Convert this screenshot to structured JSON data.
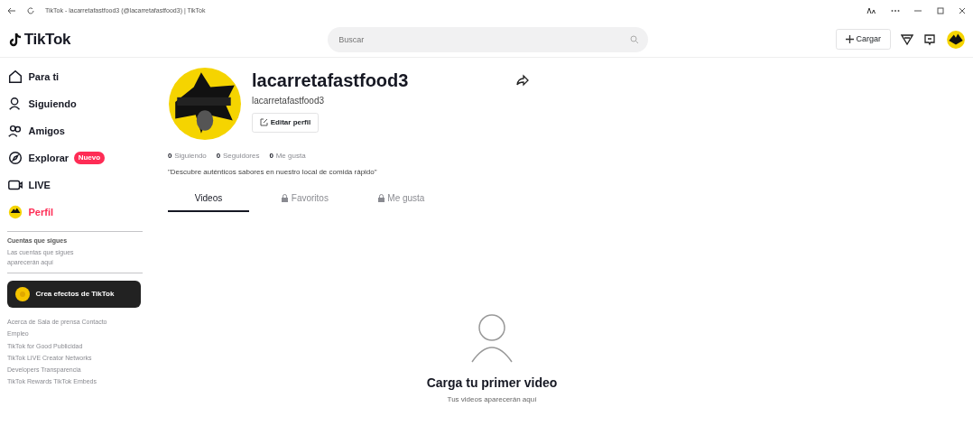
{
  "browser": {
    "title": "TikTok - lacarretafastfood3 (@lacarretafastfood3) | TikTok"
  },
  "header": {
    "logo": "TikTok",
    "search": {
      "placeholder": "Buscar"
    },
    "upload_button": "Cargar"
  },
  "sidebar": {
    "items": [
      {
        "label": "Para ti",
        "kind": "home",
        "selected": false
      },
      {
        "label": "Siguiendo",
        "kind": "following",
        "selected": false
      },
      {
        "label": "Amigos",
        "kind": "friends",
        "selected": false
      },
      {
        "label": "Explorar",
        "kind": "explore",
        "selected": false,
        "badge": "Nuevo"
      },
      {
        "label": "LIVE",
        "kind": "live",
        "selected": false
      },
      {
        "label": "Perfil",
        "kind": "profile",
        "selected": true
      }
    ],
    "following_title": "Cuentas que sigues",
    "following_hint": "Las cuentas que sigues aparecerán aquí",
    "effects_button": "Crea efectos de TikTok",
    "footer_links": [
      "Acerca de Sala de prensa Contacto",
      "Empleo",
      "TikTok for Good Publicidad",
      "TikTok LIVE Creator Networks",
      "Developers Transparencia",
      "TikTok Rewards TikTok Embeds"
    ]
  },
  "profile": {
    "username": "lacarretafastfood3",
    "handle": "lacarretafastfood3",
    "edit_button": "Editar perfil",
    "stats": [
      {
        "count": "0",
        "label": "Siguiendo"
      },
      {
        "count": "0",
        "label": "Seguidores"
      },
      {
        "count": "0",
        "label": "Me gusta"
      }
    ],
    "bio": "\"Descubre auténticos sabores en nuestro local de comida rápido\"",
    "tabs": [
      {
        "label": "Videos",
        "locked": false,
        "selected": true
      },
      {
        "label": "Favoritos",
        "locked": true,
        "selected": false
      },
      {
        "label": "Me gusta",
        "locked": true,
        "selected": false
      }
    ]
  },
  "empty_state": {
    "title": "Carga tu primer video",
    "subtitle": "Tus videos aparecerán aquí"
  }
}
